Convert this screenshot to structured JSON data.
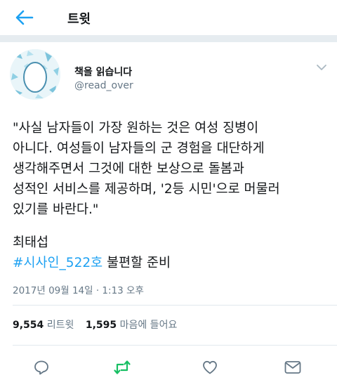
{
  "header": {
    "title": "트윗",
    "back_icon": "arrow-left-icon"
  },
  "tweet": {
    "author": {
      "display_name": "책을 읽습니다",
      "handle": "@read_over",
      "avatar_icon": "egg-avatar-icon"
    },
    "caret_icon": "chevron-down-icon",
    "text_lines": [
      "\"사실 남자들이 가장 원하는 것은 여성 징병이",
      "아니다. 여성들이 남자들의 군 경험을 대단하게",
      "생각해주면서 그것에 대한 보상으로 돌봄과",
      "성적인 서비스를 제공하며, '2등 시민'으로 머물러",
      "있기를 바란다.\""
    ],
    "attribution": "최태섭",
    "hashtag": "#시사인_522호",
    "hashtag_suffix": " 불편할 준비",
    "timestamp": "2017년 09월 14일 · 1:13 오후",
    "stats": {
      "retweets_count": "9,554",
      "retweets_label": "리트윗",
      "likes_count": "1,595",
      "likes_label": "마음에 들어요"
    }
  },
  "actions": [
    "reply-icon",
    "retweet-icon",
    "like-icon",
    "message-icon"
  ],
  "colors": {
    "accent": "#1da1f2",
    "retweet": "#17bf63",
    "secondary_text": "#657786",
    "icon": "#657786"
  }
}
